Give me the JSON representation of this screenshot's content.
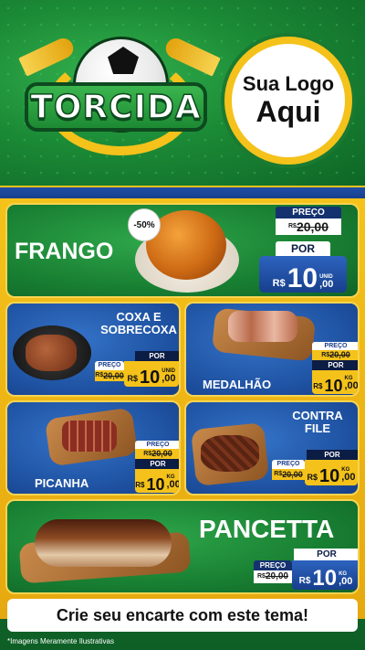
{
  "header": {
    "logo_text": "TORCIDA",
    "brand_line1": "Sua Logo",
    "brand_line2": "Aqui"
  },
  "products": [
    {
      "name": "FRANGO",
      "badge": "-50%",
      "label_top": "PREÇO",
      "old_currency": "R$",
      "old_price": "20,00",
      "label_por": "POR",
      "currency": "R$",
      "price_int": "10",
      "price_cents": ",00",
      "unit": "UNID"
    },
    {
      "name_line1": "COXA E",
      "name_line2": "SOBRECOXA",
      "label_top": "PREÇO",
      "old_currency": "R$",
      "old_price": "20,00",
      "label_por": "POR",
      "currency": "R$",
      "price_int": "10",
      "price_cents": ",00",
      "unit": "UNID"
    },
    {
      "name": "MEDALHÃO",
      "label_top": "PREÇO",
      "old_currency": "R$",
      "old_price": "20,00",
      "label_por": "POR",
      "currency": "R$",
      "price_int": "10",
      "price_cents": ",00",
      "unit": "KG"
    },
    {
      "name": "PICANHA",
      "label_top": "PREÇO",
      "old_currency": "R$",
      "old_price": "20,00",
      "label_por": "POR",
      "currency": "R$",
      "price_int": "10",
      "price_cents": ",00",
      "unit": "KG"
    },
    {
      "name_line1": "CONTRA",
      "name_line2": "FILE",
      "label_top": "PREÇO",
      "old_currency": "R$",
      "old_price": "20,00",
      "label_por": "POR",
      "currency": "R$",
      "price_int": "10",
      "price_cents": ",00",
      "unit": "KG"
    },
    {
      "name": "PANCETTA",
      "label_top": "PREÇO",
      "old_currency": "R$",
      "old_price": "20,00",
      "label_por": "POR",
      "currency": "R$",
      "price_int": "10",
      "price_cents": ",00",
      "unit": "KG"
    }
  ],
  "footer": {
    "cta": "Crie seu encarte com este tema!",
    "disclaimer": "*Imagens Meramente Ilustrativas"
  },
  "colors": {
    "green": "#1b8a36",
    "blue": "#1d4f9e",
    "yellow": "#f4c21a",
    "navy": "#0b1c45"
  }
}
